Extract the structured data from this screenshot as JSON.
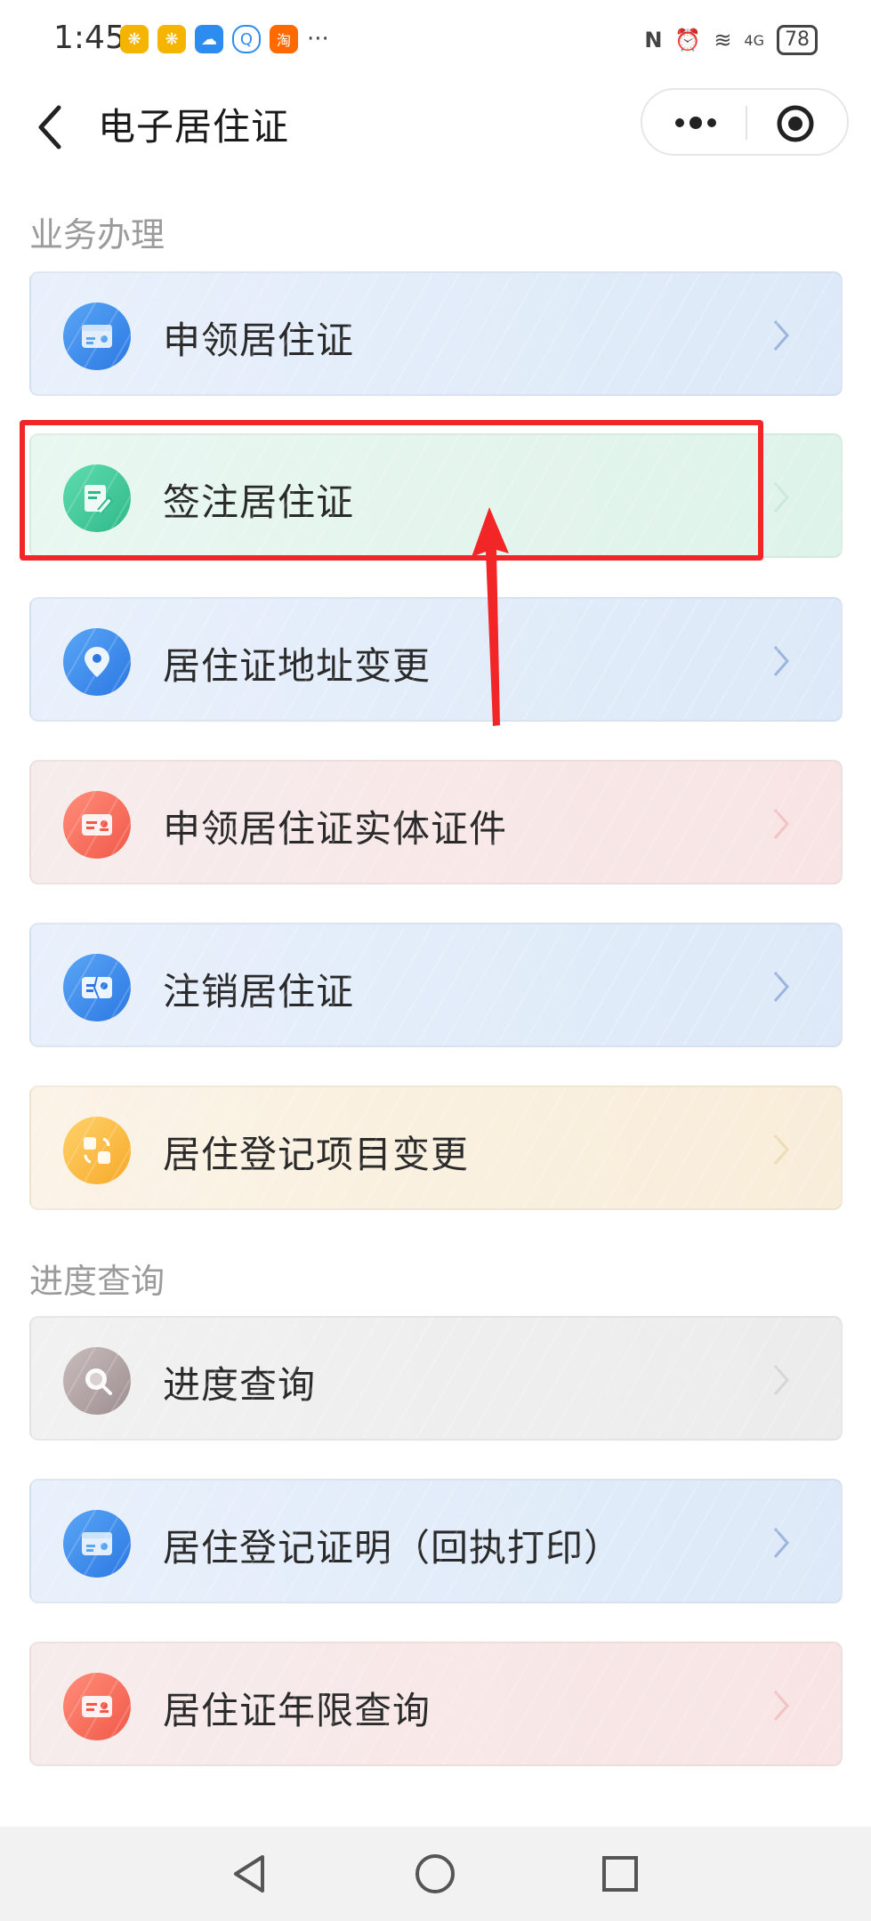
{
  "status_bar": {
    "time": "1:45",
    "notification_icons": [
      "weibo-icon",
      "weibo-icon",
      "cloud-icon",
      "chat-icon",
      "taobao-icon",
      "more-dots"
    ],
    "weibo_glyph": "❋",
    "cloud_glyph": "☁",
    "chat_glyph": "Q",
    "taobao_glyph": "淘",
    "more_glyph": "···",
    "system_icons": [
      "nfc-icon",
      "alarm-icon",
      "wifi-icon",
      "signal-icon"
    ],
    "nfc_glyph": "N",
    "alarm_glyph": "⏰",
    "wifi_glyph": "≋",
    "signal_label": "4G",
    "battery": "78"
  },
  "header": {
    "title": "电子居住证"
  },
  "sections": {
    "business": {
      "title": "业务办理"
    },
    "progress": {
      "title": "进度查询"
    }
  },
  "cards": [
    {
      "label": "申领居住证",
      "theme": "blue",
      "icon": "id-card-icon"
    },
    {
      "label": "签注居住证",
      "theme": "green",
      "icon": "sign-document-icon"
    },
    {
      "label": "居住证地址变更",
      "theme": "blue",
      "icon": "location-pin-icon"
    },
    {
      "label": "申领居住证实体证件",
      "theme": "red",
      "icon": "physical-card-icon"
    },
    {
      "label": "注销居住证",
      "theme": "blue",
      "icon": "cancel-card-icon"
    },
    {
      "label": "居住登记项目变更",
      "theme": "yellow",
      "icon": "exchange-icon"
    },
    {
      "label": "进度查询",
      "theme": "gray",
      "icon": "search-icon"
    },
    {
      "label": "居住登记证明（回执打印）",
      "theme": "blue",
      "icon": "id-card-icon"
    },
    {
      "label": "居住证年限查询",
      "theme": "red",
      "icon": "physical-card-icon"
    }
  ],
  "annotation": {
    "highlight_color": "#f22626",
    "highlighted_item": "签注居住证"
  },
  "colors": {
    "blue": "#2b78e4",
    "green": "#2fb98a",
    "red": "#f15848",
    "yellow": "#f7a92a",
    "gray": "#9e8f8f"
  }
}
